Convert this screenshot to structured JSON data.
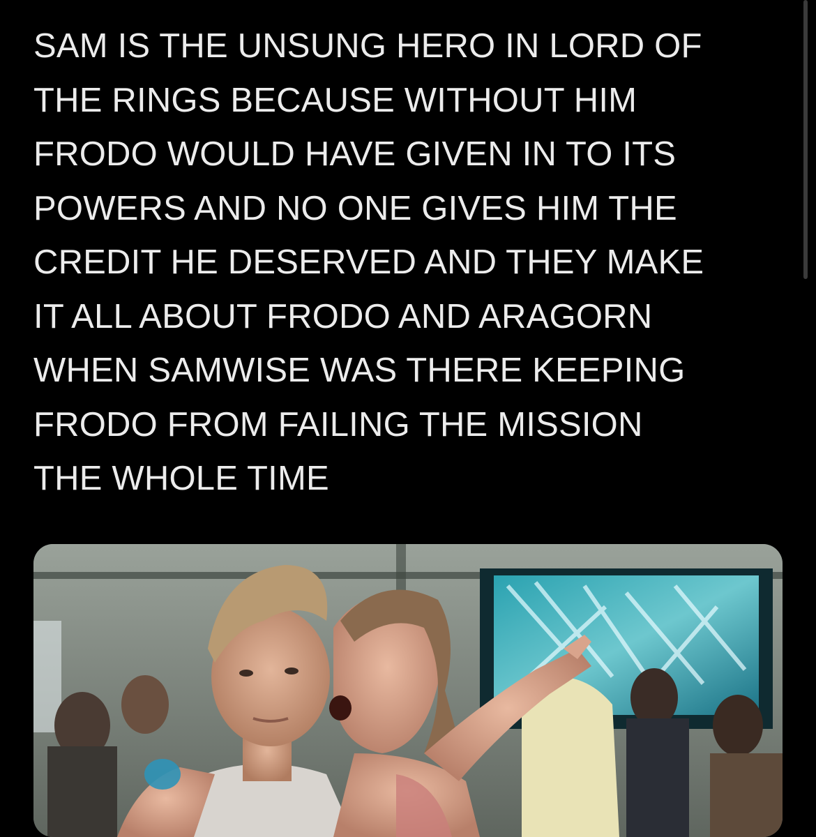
{
  "tweet": {
    "text_lines": [
      "SAM IS THE UNSUNG HERO IN LORD OF",
      "THE RINGS BECAUSE WITHOUT HIM",
      "FRODO WOULD HAVE GIVEN IN TO ITS",
      "POWERS AND NO ONE GIVES HIM THE",
      "CREDIT HE DESERVED AND THEY MAKE",
      "IT ALL ABOUT FRODO AND ARAGORN",
      "WHEN SAMWISE WAS THERE KEEPING",
      "FRODO FROM FAILING THE MISSION",
      "THE WHOLE TIME"
    ]
  },
  "media": {
    "kind": "photo"
  },
  "colors": {
    "background": "#000000",
    "text": "#ececec",
    "scrollbar": "#3a3a3a"
  }
}
